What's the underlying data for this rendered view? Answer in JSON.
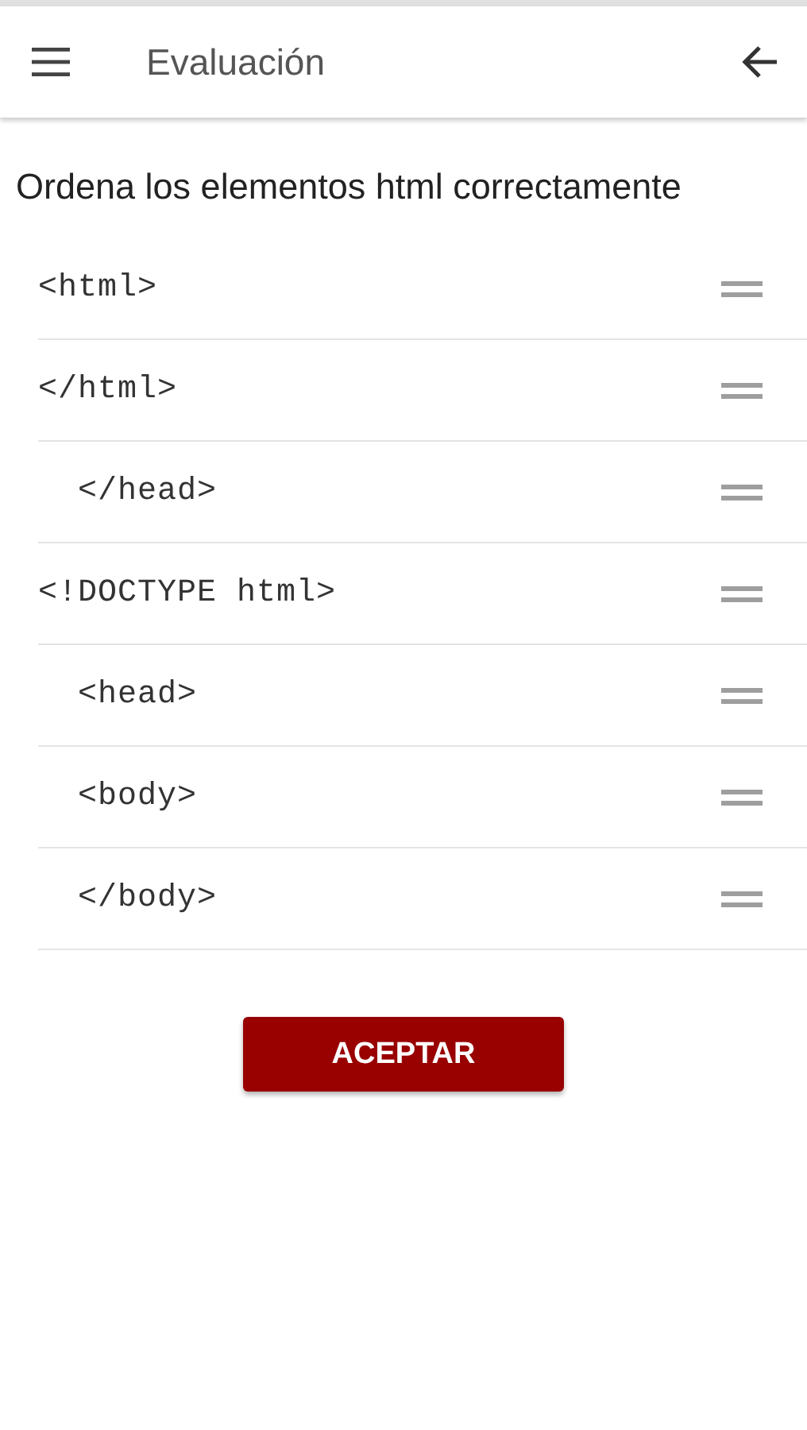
{
  "app_bar": {
    "title": "Evaluación"
  },
  "question": "Ordena los elementos html correctamente",
  "items": [
    {
      "text": "<html>"
    },
    {
      "text": "</html>"
    },
    {
      "text": "  </head>"
    },
    {
      "text": "<!DOCTYPE html>"
    },
    {
      "text": "  <head>"
    },
    {
      "text": "  <body>"
    },
    {
      "text": "  </body>"
    }
  ],
  "button": "ACEPTAR"
}
